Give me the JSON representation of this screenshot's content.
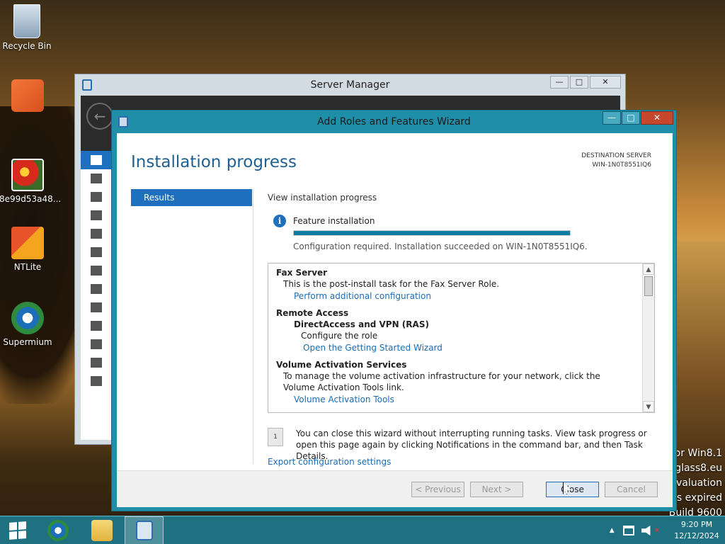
{
  "desktop": {
    "icons": [
      {
        "label": "Recycle Bin"
      },
      {
        "label": ""
      },
      {
        "label": "8e99d53a48..."
      },
      {
        "label": "NTLite"
      },
      {
        "label": "Supermium"
      }
    ],
    "watermark": [
      "or Win8.1",
      ".glass8.eu",
      "evaluation",
      "is expired",
      "Build 9600"
    ]
  },
  "server_manager": {
    "title": "Server Manager",
    "controls": {
      "minimize": "—",
      "maximize": "□",
      "close": "✕"
    }
  },
  "wizard": {
    "title": "Add Roles and Features Wizard",
    "controls": {
      "minimize": "—",
      "maximize": "□",
      "close": "✕"
    },
    "page_title": "Installation progress",
    "destination": {
      "label": "DESTINATION SERVER",
      "value": "WIN-1N0T8551IQ6"
    },
    "steps": [
      {
        "label": "Results",
        "active": true
      }
    ],
    "view_label": "View installation progress",
    "feature_label": "Feature installation",
    "progress_fraction": 1.0,
    "status_text": "Configuration required. Installation succeeded on WIN-1N0T8551IQ6.",
    "results": {
      "fax": {
        "title": "Fax Server",
        "text": "This is the post-install task for the Fax Server Role.",
        "link": "Perform additional configuration"
      },
      "remote": {
        "title": "Remote Access",
        "sub_title": "DirectAccess and VPN (RAS)",
        "text": "Configure the role",
        "link": "Open the Getting Started Wizard"
      },
      "vas": {
        "title": "Volume Activation Services",
        "text": "To manage the volume activation infrastructure for your network, click the Volume Activation Tools link.",
        "link": "Volume Activation Tools"
      }
    },
    "note": "You can close this wizard without interrupting running tasks. View task progress or open this page again by clicking Notifications in the command bar, and then Task Details.",
    "export_link": "Export configuration settings",
    "buttons": {
      "previous": "< Previous",
      "next": "Next >",
      "close": "Close",
      "cancel": "Cancel"
    }
  },
  "taskbar": {
    "clock_time": "9:20 PM",
    "clock_date": "12/12/2024"
  },
  "colors": {
    "accent": "#1f6fbf",
    "wizard_frame": "#1f8ea8",
    "link": "#1b6bb5",
    "progress": "#0f7da1"
  }
}
